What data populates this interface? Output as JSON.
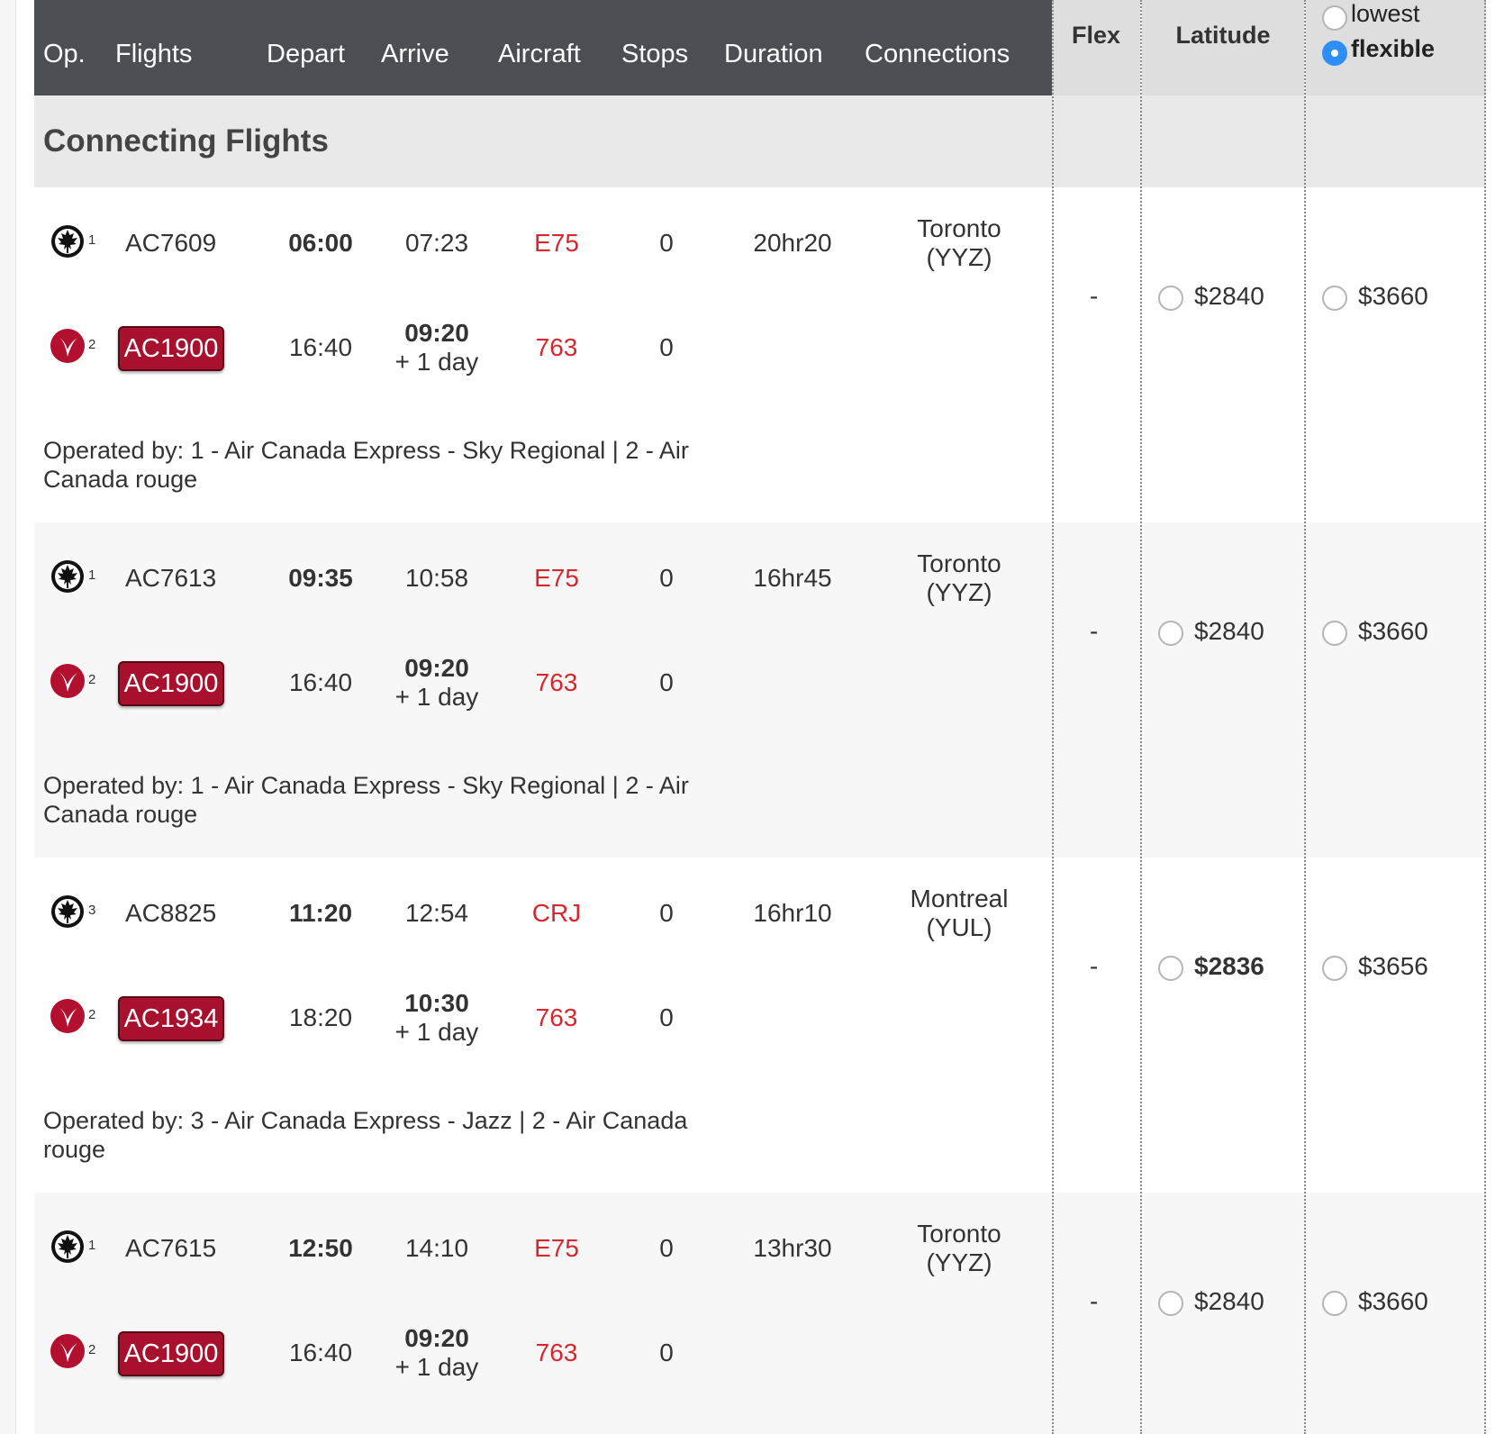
{
  "header": {
    "columns": [
      "Op.",
      "Flights",
      "Depart",
      "Arrive",
      "Aircraft",
      "Stops",
      "Duration",
      "Connections"
    ],
    "fare_columns": [
      "Flex",
      "Latitude"
    ],
    "fare_toggle": {
      "options": [
        "lowest",
        "flexible"
      ],
      "selected": "flexible"
    }
  },
  "section_title": "Connecting Flights",
  "colors": {
    "header_bg": "#4b4f54",
    "rouge_badge": "#a8112e",
    "aircraft_text": "#d8262e",
    "radio_selected": "#2f8ef5"
  },
  "itineraries": [
    {
      "legs": [
        {
          "op_icon": "air-canada-maple-leaf-icon",
          "op_num": "1",
          "flight": "AC7609",
          "rouge": false,
          "depart": "06:00",
          "depart_bold": true,
          "arrive": "07:23",
          "arrive_extra": "",
          "aircraft": "E75",
          "stops": "0",
          "duration": "20hr20",
          "connection_city": "Toronto",
          "connection_code": "(YYZ)"
        },
        {
          "op_icon": "air-canada-rouge-icon",
          "op_num": "2",
          "flight": "AC1900",
          "rouge": true,
          "depart": "16:40",
          "depart_bold": false,
          "arrive": "09:20",
          "arrive_extra": "+ 1 day",
          "aircraft": "763",
          "stops": "0",
          "duration": "",
          "connection_city": "",
          "connection_code": ""
        }
      ],
      "operated_by": "Operated by: 1 - Air Canada Express - Sky Regional | 2 - Air Canada rouge",
      "flex": "-",
      "latitude": "$2840",
      "latitude_bold": false,
      "flexible_price": "$3660"
    },
    {
      "legs": [
        {
          "op_icon": "air-canada-maple-leaf-icon",
          "op_num": "1",
          "flight": "AC7613",
          "rouge": false,
          "depart": "09:35",
          "depart_bold": true,
          "arrive": "10:58",
          "arrive_extra": "",
          "aircraft": "E75",
          "stops": "0",
          "duration": "16hr45",
          "connection_city": "Toronto",
          "connection_code": "(YYZ)"
        },
        {
          "op_icon": "air-canada-rouge-icon",
          "op_num": "2",
          "flight": "AC1900",
          "rouge": true,
          "depart": "16:40",
          "depart_bold": false,
          "arrive": "09:20",
          "arrive_extra": "+ 1 day",
          "aircraft": "763",
          "stops": "0",
          "duration": "",
          "connection_city": "",
          "connection_code": ""
        }
      ],
      "operated_by": "Operated by: 1 - Air Canada Express - Sky Regional | 2 - Air Canada rouge",
      "flex": "-",
      "latitude": "$2840",
      "latitude_bold": false,
      "flexible_price": "$3660"
    },
    {
      "legs": [
        {
          "op_icon": "air-canada-maple-leaf-icon",
          "op_num": "3",
          "flight": "AC8825",
          "rouge": false,
          "depart": "11:20",
          "depart_bold": true,
          "arrive": "12:54",
          "arrive_extra": "",
          "aircraft": "CRJ",
          "stops": "0",
          "duration": "16hr10",
          "connection_city": "Montreal",
          "connection_code": "(YUL)"
        },
        {
          "op_icon": "air-canada-rouge-icon",
          "op_num": "2",
          "flight": "AC1934",
          "rouge": true,
          "depart": "18:20",
          "depart_bold": false,
          "arrive": "10:30",
          "arrive_extra": "+ 1 day",
          "aircraft": "763",
          "stops": "0",
          "duration": "",
          "connection_city": "",
          "connection_code": ""
        }
      ],
      "operated_by": "Operated by: 3 - Air Canada Express - Jazz | 2 - Air Canada rouge",
      "flex": "-",
      "latitude": "$2836",
      "latitude_bold": true,
      "flexible_price": "$3656"
    },
    {
      "legs": [
        {
          "op_icon": "air-canada-maple-leaf-icon",
          "op_num": "1",
          "flight": "AC7615",
          "rouge": false,
          "depart": "12:50",
          "depart_bold": true,
          "arrive": "14:10",
          "arrive_extra": "",
          "aircraft": "E75",
          "stops": "0",
          "duration": "13hr30",
          "connection_city": "Toronto",
          "connection_code": "(YYZ)"
        },
        {
          "op_icon": "air-canada-rouge-icon",
          "op_num": "2",
          "flight": "AC1900",
          "rouge": true,
          "depart": "16:40",
          "depart_bold": false,
          "arrive": "09:20",
          "arrive_extra": "+ 1 day",
          "aircraft": "763",
          "stops": "0",
          "duration": "",
          "connection_city": "",
          "connection_code": ""
        }
      ],
      "operated_by": "",
      "flex": "-",
      "latitude": "$2840",
      "latitude_bold": false,
      "flexible_price": "$3660"
    }
  ]
}
